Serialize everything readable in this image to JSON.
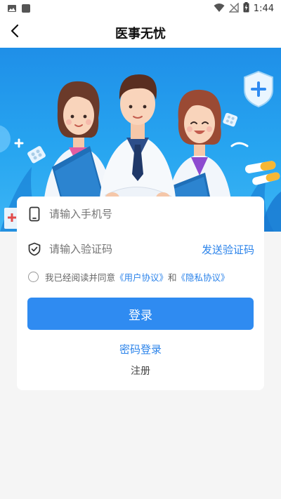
{
  "status": {
    "time": "1:44",
    "icons": [
      "image-icon",
      "square-icon",
      "wifi-icon",
      "no-signal-icon",
      "battery-charging-icon"
    ]
  },
  "header": {
    "title": "医事无忧",
    "back_icon": "chevron-left-icon"
  },
  "login": {
    "phone_placeholder": "请输入手机号",
    "code_placeholder": "请输入验证码",
    "send_code": "发送验证码",
    "agreement_prefix": "我已经阅读并同意",
    "user_agreement": "《用户协议》",
    "and": "和",
    "privacy_policy": "《隐私协议》",
    "login_button": "登录",
    "password_login": "密码登录",
    "register": "注册"
  },
  "colors": {
    "accent": "#2f8bf1",
    "link": "#2b83ea",
    "banner": "#27a5f0"
  }
}
